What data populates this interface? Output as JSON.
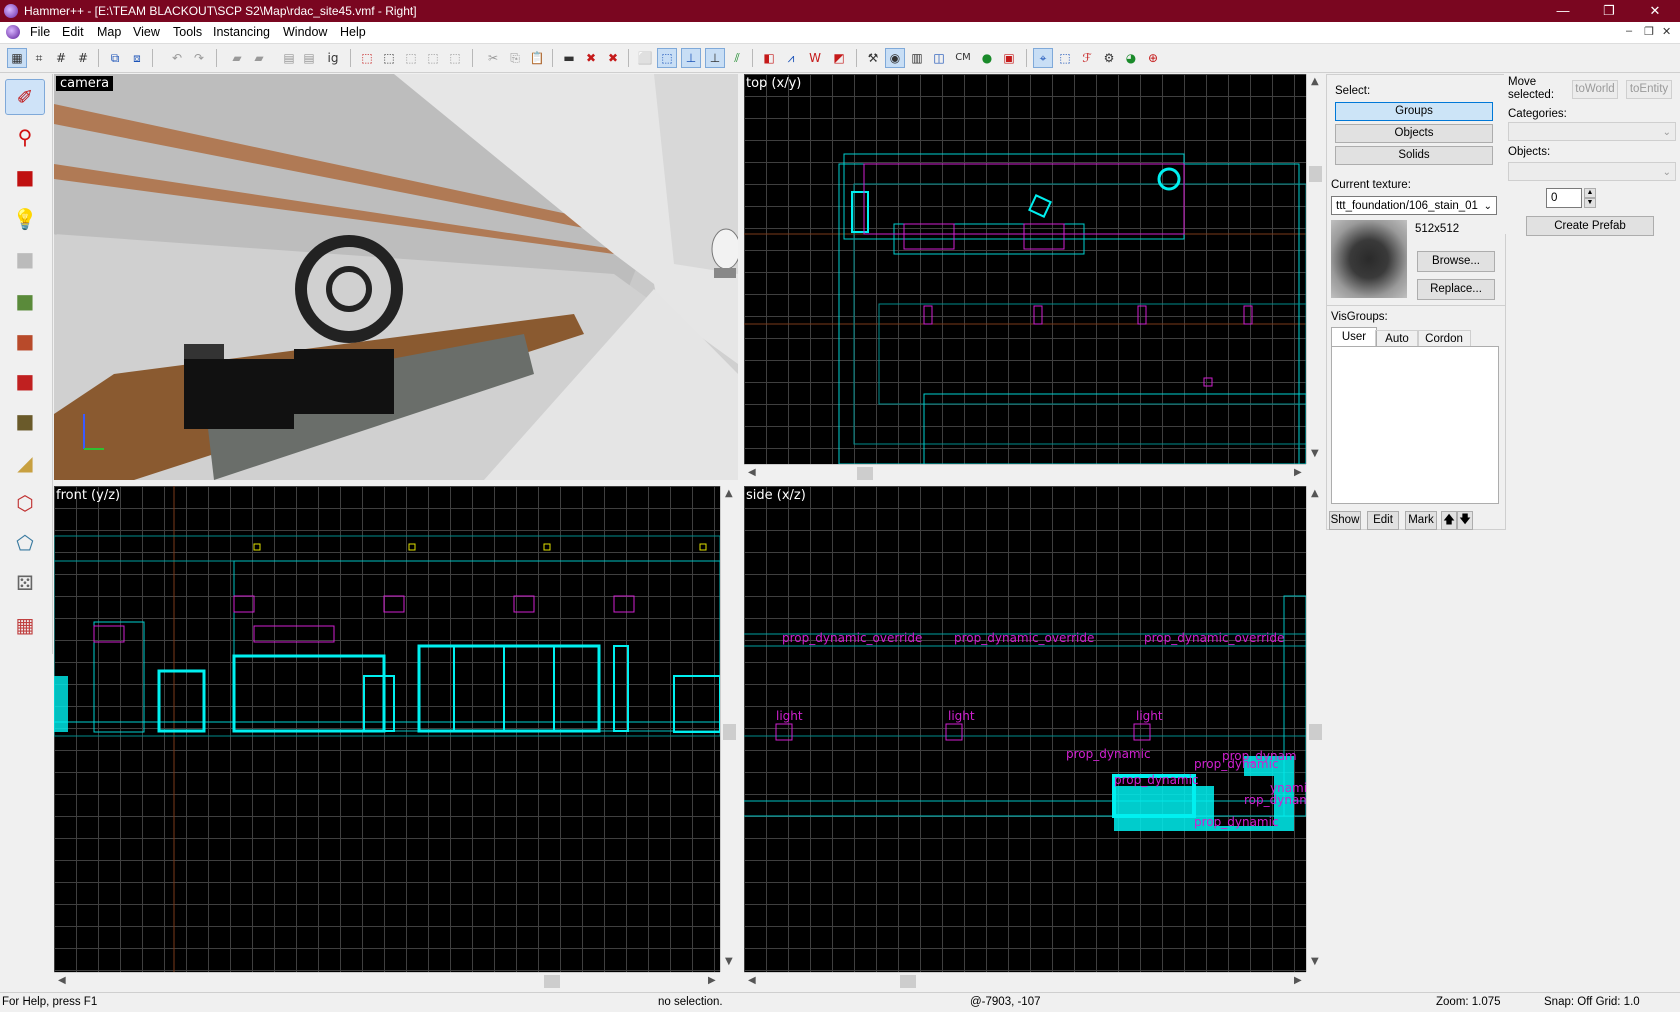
{
  "window": {
    "title": "Hammer++ - [E:\\TEAM BLACKOUT\\SCP S2\\Map\\rdac_site45.vmf - Right]",
    "controls": {
      "minimize": "—",
      "maximize": "❐",
      "close": "✕"
    }
  },
  "menu": {
    "items": [
      "File",
      "Edit",
      "Map",
      "View",
      "Tools",
      "Instancing",
      "Window",
      "Help"
    ],
    "mdi_controls": [
      "–",
      "❐",
      "✕"
    ]
  },
  "toolbar": {
    "cm_label": "CM",
    "ig_label": "ig"
  },
  "tools": [
    {
      "name": "selection-tool",
      "icon": "✐"
    },
    {
      "name": "magnify-tool",
      "icon": "⚲"
    },
    {
      "name": "camera-tool",
      "icon": "■"
    },
    {
      "name": "entity-tool",
      "icon": "💡"
    },
    {
      "name": "block-tool",
      "icon": "■"
    },
    {
      "name": "texture-application-tool",
      "icon": "■"
    },
    {
      "name": "apply-texture-tool",
      "icon": "■"
    },
    {
      "name": "decal-tool",
      "icon": "■"
    },
    {
      "name": "overlay-tool",
      "icon": "■"
    },
    {
      "name": "clipping-tool",
      "icon": "◢"
    },
    {
      "name": "vertex-tool",
      "icon": "⬡"
    },
    {
      "name": "path-tool",
      "icon": "⬠"
    },
    {
      "name": "sprinkle-tool",
      "icon": "⚄"
    },
    {
      "name": "paint-tool",
      "icon": "▦"
    }
  ],
  "viewports": {
    "camera": {
      "label": "camera"
    },
    "top": {
      "label": "top (x/y)"
    },
    "front": {
      "label": "front (y/z)"
    },
    "side": {
      "label": "side (x/z)",
      "entity_labels": [
        "prop_dynamic_override",
        "prop_dynamic_override",
        "prop_dynamic_override",
        "light",
        "light",
        "light",
        "prop_dynamic",
        "prop_dynamic",
        "prop_dynamic",
        "prop_dynam",
        "prop_dynamic",
        "rop_dynamic",
        "ynamic"
      ]
    }
  },
  "select_panel": {
    "heading": "Select:",
    "buttons": [
      "Groups",
      "Objects",
      "Solids"
    ],
    "current_texture_label": "Current texture:",
    "current_texture": "ttt_foundation/106_stain_01",
    "texture_size": "512x512",
    "browse": "Browse...",
    "replace": "Replace..."
  },
  "visgroups": {
    "heading": "VisGroups:",
    "tabs": [
      "User",
      "Auto",
      "Cordon"
    ],
    "buttons": [
      "Show",
      "Edit",
      "Mark"
    ]
  },
  "prefab_panel": {
    "move_selected": "Move selected:",
    "to_world": "toWorld",
    "to_entity": "toEntity",
    "categories_label": "Categories:",
    "objects_label": "Objects:",
    "count": "0",
    "create_prefab": "Create Prefab"
  },
  "status": {
    "help": "For Help, press F1",
    "selection": "no selection.",
    "coords": "@-7903, -107",
    "zoom": "Zoom: 1.075",
    "snap": "Snap: Off Grid: 1.0"
  },
  "colors": {
    "titlebar": "#7a0620",
    "wire_cyan": "#00f0f0",
    "wire_magenta": "#d020d0",
    "grid": "#3f3f3f"
  }
}
